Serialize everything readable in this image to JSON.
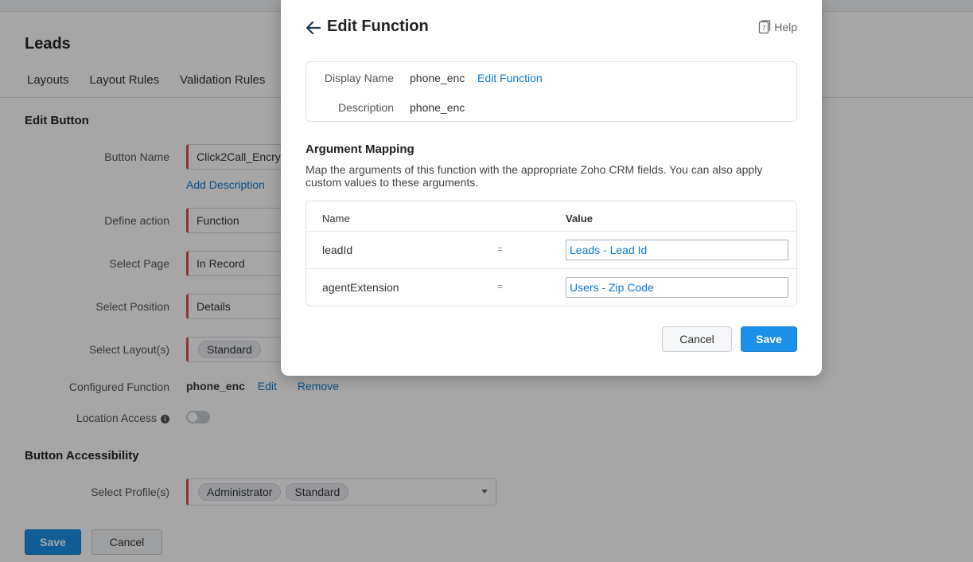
{
  "page": {
    "module_title": "Leads",
    "tabs": [
      "Layouts",
      "Layout Rules",
      "Validation Rules"
    ],
    "edit_section_title": "Edit Button",
    "button_name_label": "Button Name",
    "button_name_value": "Click2Call_Encry",
    "add_description": "Add Description",
    "define_action_label": "Define action",
    "define_action_value": "Function",
    "select_page_label": "Select Page",
    "select_page_value": "In Record",
    "select_position_label": "Select Position",
    "select_position_value": "Details",
    "select_layouts_label": "Select Layout(s)",
    "select_layouts_chip": "Standard",
    "configured_function_label": "Configured Function",
    "configured_function_value": "phone_enc",
    "edit_link": "Edit",
    "remove_link": "Remove",
    "location_access_label": "Location Access",
    "location_access_enabled": false,
    "accessibility_title": "Button Accessibility",
    "select_profiles_label": "Select Profile(s)",
    "profiles": [
      "Administrator",
      "Standard"
    ],
    "save_label": "Save",
    "cancel_label": "Cancel"
  },
  "modal": {
    "title": "Edit Function",
    "help_label": "Help",
    "display_name_label": "Display Name",
    "display_name_value": "phone_enc",
    "edit_function_link": "Edit Function",
    "description_label": "Description",
    "description_value": "phone_enc",
    "argument_mapping_title": "Argument Mapping",
    "argument_mapping_desc": "Map the arguments of this function with the appropriate Zoho CRM fields. You can also apply custom values to these arguments.",
    "col_name": "Name",
    "col_value": "Value",
    "rows": [
      {
        "name": "leadId",
        "eq": "=",
        "value": "Leads - Lead Id"
      },
      {
        "name": "agentExtension",
        "eq": "=",
        "value": "Users - Zip Code"
      }
    ],
    "cancel_label": "Cancel",
    "save_label": "Save"
  },
  "colors": {
    "accent": "#1a90e8",
    "link": "#0b79d0",
    "required_border": "#d9534f"
  }
}
